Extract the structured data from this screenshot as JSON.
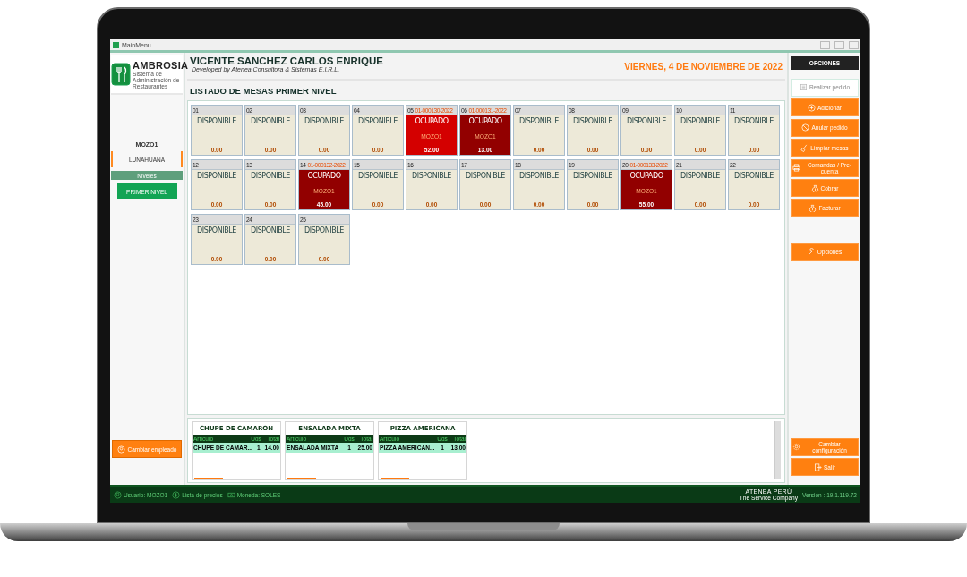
{
  "window": {
    "title": "MainMenu"
  },
  "sidebar": {
    "logo": {
      "name": "AMBROSIA",
      "tagline": "Sistema de Administración de Restaurantes"
    },
    "user": "MOZO1",
    "location": "LUNAHUANA",
    "levels_header": "Niveles",
    "levels": [
      {
        "label": "PRIMER NIVEL",
        "selected": true
      }
    ],
    "change_employee": "Cambiar empleado"
  },
  "header": {
    "name": "VICENTE SANCHEZ CARLOS ENRIQUE",
    "developer": "Developed by Atenea Consultora & Sistemas E.I.R.L.",
    "date": "VIERNES, 4 DE NOVIEMBRE DE 2022"
  },
  "tables_title": "LISTADO DE MESAS PRIMER NIVEL",
  "tables": [
    {
      "number": "01",
      "kind": "free",
      "status": "DISPONIBLE",
      "total": "0.00"
    },
    {
      "number": "02",
      "kind": "free",
      "status": "DISPONIBLE",
      "total": "0.00"
    },
    {
      "number": "03",
      "kind": "free",
      "status": "DISPONIBLE",
      "total": "0.00"
    },
    {
      "number": "04",
      "kind": "free",
      "status": "DISPONIBLE",
      "total": "0.00"
    },
    {
      "number": "05",
      "kind": "occupied",
      "order": "01-000130-2022",
      "status": "OCUPADO",
      "waiter": "MOZO1",
      "total": "52.00",
      "color": "#d40000"
    },
    {
      "number": "06",
      "kind": "occupied",
      "order": "01-000131-2022",
      "status": "OCUPADO",
      "waiter": "MOZO1",
      "total": "13.00",
      "color": "#920000"
    },
    {
      "number": "07",
      "kind": "free",
      "status": "DISPONIBLE",
      "total": "0.00"
    },
    {
      "number": "08",
      "kind": "free",
      "status": "DISPONIBLE",
      "total": "0.00"
    },
    {
      "number": "09",
      "kind": "free",
      "status": "DISPONIBLE",
      "total": "0.00"
    },
    {
      "number": "10",
      "kind": "free",
      "status": "DISPONIBLE",
      "total": "0.00"
    },
    {
      "number": "11",
      "kind": "free",
      "status": "DISPONIBLE",
      "total": "0.00"
    },
    {
      "number": "12",
      "kind": "free",
      "status": "DISPONIBLE",
      "total": "0.00"
    },
    {
      "number": "13",
      "kind": "free",
      "status": "DISPONIBLE",
      "total": "0.00"
    },
    {
      "number": "14",
      "kind": "occupied",
      "order": "01-000132-2022",
      "status": "OCUPADO",
      "waiter": "MOZO1",
      "total": "45.00",
      "color": "#920000"
    },
    {
      "number": "15",
      "kind": "free",
      "status": "DISPONIBLE",
      "total": "0.00"
    },
    {
      "number": "16",
      "kind": "free",
      "status": "DISPONIBLE",
      "total": "0.00"
    },
    {
      "number": "17",
      "kind": "free",
      "status": "DISPONIBLE",
      "total": "0.00"
    },
    {
      "number": "18",
      "kind": "free",
      "status": "DISPONIBLE",
      "total": "0.00"
    },
    {
      "number": "19",
      "kind": "free",
      "status": "DISPONIBLE",
      "total": "0.00"
    },
    {
      "number": "20",
      "kind": "occupied",
      "order": "01-000133-2022",
      "status": "OCUPADO",
      "waiter": "MOZO1",
      "total": "55.00",
      "color": "#920000"
    },
    {
      "number": "21",
      "kind": "free",
      "status": "DISPONIBLE",
      "total": "0.00"
    },
    {
      "number": "22",
      "kind": "free",
      "status": "DISPONIBLE",
      "total": "0.00"
    },
    {
      "number": "23",
      "kind": "free",
      "status": "DISPONIBLE",
      "total": "0.00"
    },
    {
      "number": "24",
      "kind": "free",
      "status": "DISPONIBLE",
      "total": "0.00"
    },
    {
      "number": "25",
      "kind": "free",
      "status": "DISPONIBLE",
      "total": "0.00"
    }
  ],
  "orders": [
    {
      "title": "CHUPE DE CAMARON",
      "columns": [
        "Artículo",
        "Uds",
        "Total"
      ],
      "items": [
        {
          "article": "CHUPE DE CAMAR...",
          "units": "1",
          "total": "14.00"
        }
      ]
    },
    {
      "title": "ENSALADA MIXTA",
      "columns": [
        "Artículo",
        "Uds",
        "Total"
      ],
      "items": [
        {
          "article": "ENSALADA MIXTA",
          "units": "1",
          "total": "25.00"
        }
      ]
    },
    {
      "title": "PIZZA AMERICANA",
      "columns": [
        "Artículo",
        "Uds",
        "Total"
      ],
      "items": [
        {
          "article": "PIZZA AMERICAN...",
          "units": "1",
          "total": "13.00"
        }
      ]
    }
  ],
  "options": {
    "title": "OPCIONES",
    "buttons": [
      {
        "label": "Realizar pedido",
        "disabled": true
      },
      {
        "label": "Adicionar",
        "disabled": false
      },
      {
        "label": "Anular pedido",
        "disabled": false
      },
      {
        "label": "Limpiar mesas",
        "disabled": false
      },
      {
        "label": "Comandas / Pre-cuenta",
        "disabled": false
      },
      {
        "label": "Cobrar",
        "disabled": false
      },
      {
        "label": "Facturar",
        "disabled": false
      }
    ],
    "extra": [
      {
        "label": "Opciones",
        "disabled": false
      }
    ],
    "footer": [
      {
        "label": "Cambiar configuración",
        "disabled": false
      },
      {
        "label": "Salir",
        "disabled": false
      }
    ]
  },
  "status_bar": {
    "user": "Usuario: MOZO1",
    "price_list": "Lista de precios",
    "currency": "Moneda: SOLES",
    "brand": "ATENEA PERÚ",
    "brand_tagline": "The Service Company",
    "version": "Versión : 19.1.119.72"
  }
}
